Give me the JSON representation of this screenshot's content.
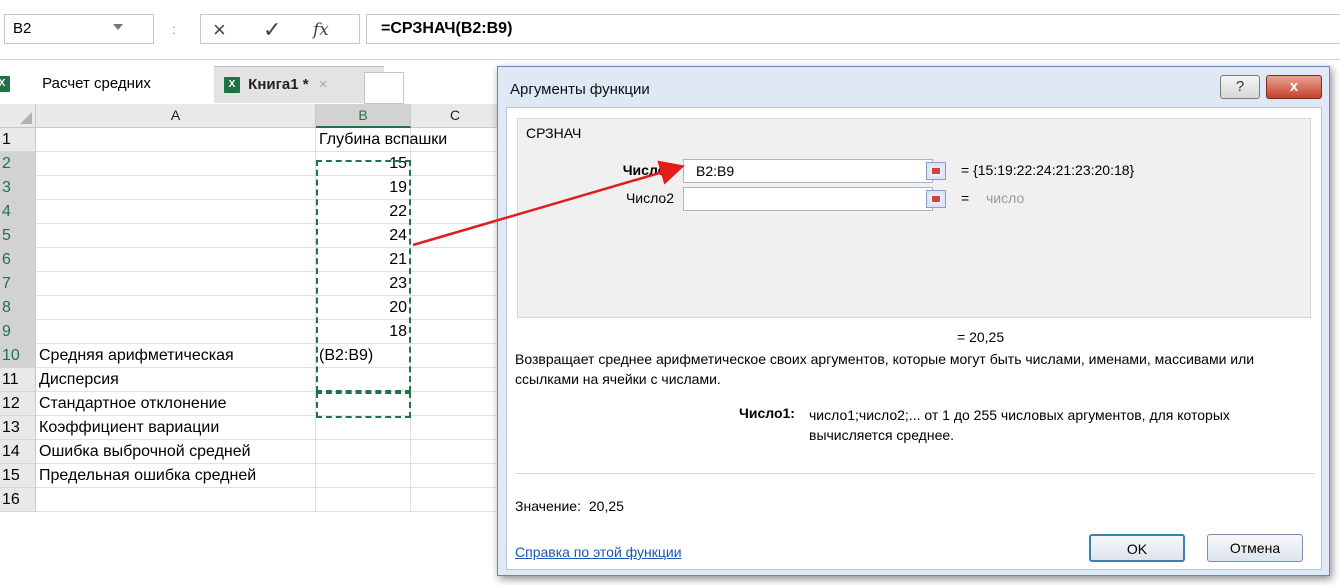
{
  "formula_bar": {
    "name_box": "B2",
    "separator": ":",
    "cancel_icon": "×",
    "enter_icon": "✓",
    "fx_label": "fx",
    "formula": "=СРЗНАЧ(B2:B9)"
  },
  "tabs": {
    "sheet_tab": "Расчет средних",
    "book_tab": "Книга1 *",
    "book_tab_close": "×"
  },
  "grid": {
    "columns": [
      "A",
      "B",
      "C"
    ],
    "rows": [
      {
        "n": "1",
        "a": "",
        "b": "Глубина вспашки"
      },
      {
        "n": "2",
        "a": "",
        "b": "15"
      },
      {
        "n": "3",
        "a": "",
        "b": "19"
      },
      {
        "n": "4",
        "a": "",
        "b": "22"
      },
      {
        "n": "5",
        "a": "",
        "b": "24"
      },
      {
        "n": "6",
        "a": "",
        "b": "21"
      },
      {
        "n": "7",
        "a": "",
        "b": "23"
      },
      {
        "n": "8",
        "a": "",
        "b": "20"
      },
      {
        "n": "9",
        "a": "",
        "b": "18"
      },
      {
        "n": "10",
        "a": "Средняя арифметическая",
        "b": "(B2:B9)"
      },
      {
        "n": "11",
        "a": "Дисперсия",
        "b": ""
      },
      {
        "n": "12",
        "a": "Стандартное отклонение",
        "b": ""
      },
      {
        "n": "13",
        "a": "Коэффициент вариации",
        "b": ""
      },
      {
        "n": "14",
        "a": "Ошибка выброчной средней",
        "b": ""
      },
      {
        "n": "15",
        "a": "Предельная ошибка  средней",
        "b": ""
      },
      {
        "n": "16",
        "a": "",
        "b": ""
      }
    ]
  },
  "dialog": {
    "title": "Аргументы функции",
    "help_btn": "?",
    "close_btn": "x",
    "function_name": "СРЗНАЧ",
    "arg1_label": "Число1",
    "arg1_value": "B2:B9",
    "arg1_result": "=  {15:19:22:24:21:23:20:18}",
    "arg2_label": "Число2",
    "arg2_value": "",
    "arg2_result_eq": "=",
    "arg2_result": "число",
    "formula_result": "=  20,25",
    "description": "Возвращает среднее арифметическое своих аргументов, которые могут быть числами, именами, массивами или ссылками на ячейки с числами.",
    "arg_help_label": "Число1:",
    "arg_help_text": "число1;число2;... от 1 до 255 числовых аргументов, для которых вычисляется среднее.",
    "value_label": "Значение:",
    "value": "20,25",
    "help_link": "Справка по этой функции",
    "ok_button": "OK",
    "cancel_button": "Отмена"
  },
  "colors": {
    "accent_green": "#217346",
    "arrow": "#e31b1b",
    "dialog_bg": "#dfe9f5"
  }
}
